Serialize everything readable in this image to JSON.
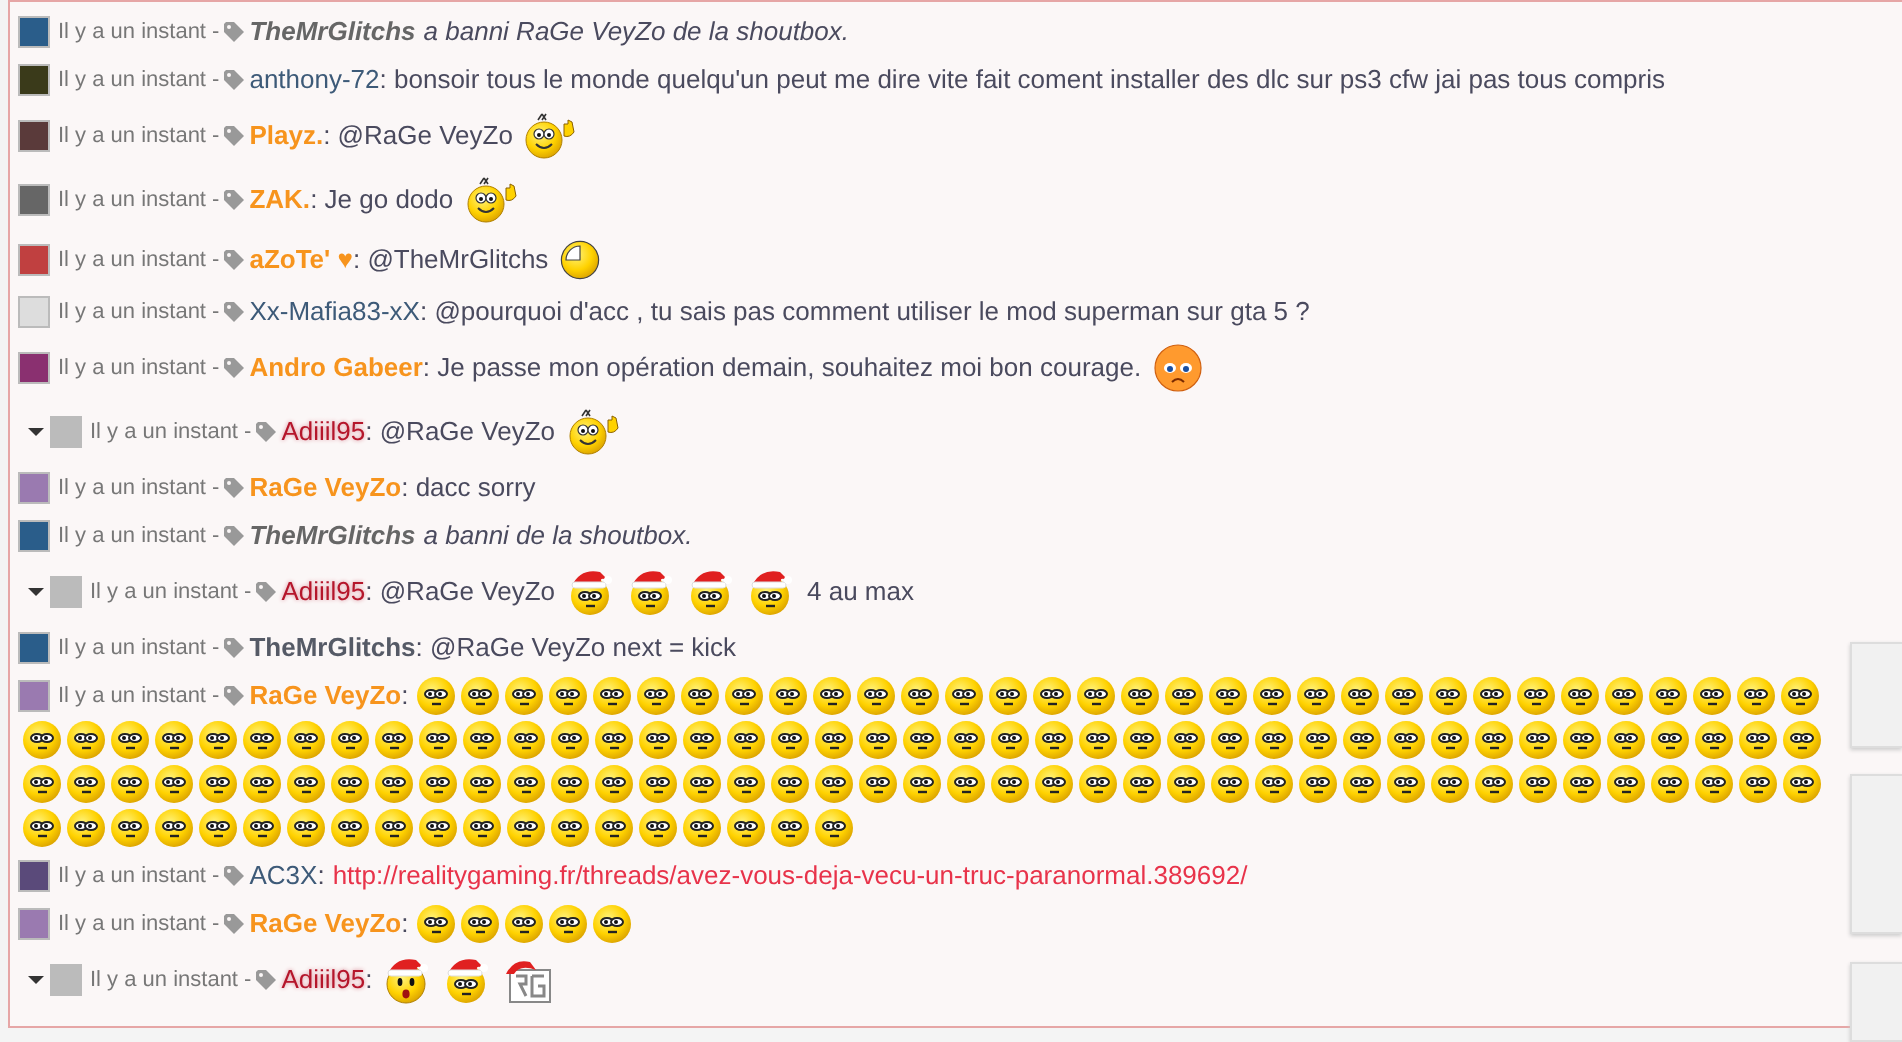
{
  "messages": [
    {
      "time": "Il y a un instant - ",
      "kind": "system",
      "caret": false,
      "user": "TheMrGlitchs",
      "text": "a banni RaGe VeyZo de la shoutbox."
    },
    {
      "time": "Il y a un instant - ",
      "kind": "member",
      "caret": false,
      "user": "anthony-72",
      "text": ": bonsoir tous le monde quelqu'un peut me dire vite fait coment installer des dlc sur ps3 cfw jai pas tous compris"
    },
    {
      "time": "Il y a un instant - ",
      "kind": "vip",
      "caret": false,
      "user": "Playz.",
      "text": ": @RaGe VeyZo",
      "emoticons": [
        {
          "kind": "wave"
        }
      ]
    },
    {
      "time": "Il y a un instant - ",
      "kind": "vip",
      "caret": false,
      "user": "ZAK.",
      "text": ": Je go dodo",
      "emoticons": [
        {
          "kind": "wave"
        }
      ]
    },
    {
      "time": "Il y a un instant - ",
      "kind": "vip",
      "caret": false,
      "user": "aZoTe' ♥",
      "text": ": @TheMrGlitchs",
      "emoticons": [
        {
          "kind": "clock"
        }
      ]
    },
    {
      "time": "Il y a un instant - ",
      "kind": "member",
      "caret": false,
      "user": "Xx-Mafia83-xX",
      "text": ": @pourquoi d'acc , tu sais pas comment utiliser le mod superman sur gta 5 ?"
    },
    {
      "time": "Il y a un instant - ",
      "kind": "vip",
      "caret": false,
      "user": "Andro Gabeer",
      "text": ": Je passe mon opération demain, souhaitez moi bon courage.",
      "emoticons": [
        {
          "kind": "sad"
        }
      ]
    },
    {
      "time": "Il y a un instant - ",
      "kind": "staff",
      "caret": true,
      "user": "Adiiil95",
      "text": ": @RaGe VeyZo",
      "emoticons": [
        {
          "kind": "wave"
        }
      ]
    },
    {
      "time": "Il y a un instant - ",
      "kind": "vip",
      "caret": false,
      "user": "RaGe VeyZo",
      "text": ": dacc sorry"
    },
    {
      "time": "Il y a un instant - ",
      "kind": "system",
      "caret": false,
      "user": "TheMrGlitchs",
      "text": "a banni de la shoutbox."
    },
    {
      "time": "Il y a un instant - ",
      "kind": "staff",
      "caret": true,
      "user": "Adiiil95",
      "text": ": @RaGe VeyZo",
      "emoticons": [
        {
          "kind": "santa"
        },
        {
          "kind": "santa"
        },
        {
          "kind": "santa"
        },
        {
          "kind": "santa"
        }
      ],
      "after": "4 au max"
    },
    {
      "time": "Il y a un instant - ",
      "kind": "admin",
      "caret": false,
      "user": "TheMrGlitchs",
      "text": ": @RaGe VeyZo next = kick"
    },
    {
      "time": "Il y a un instant - ",
      "kind": "vip",
      "caret": false,
      "user": "RaGe VeyZo",
      "text": ":",
      "emoticons": [
        {
          "kind": "cool"
        },
        {
          "kind": "cool"
        },
        {
          "kind": "cool"
        },
        {
          "kind": "cool"
        },
        {
          "kind": "cool"
        },
        {
          "kind": "cool"
        },
        {
          "kind": "cool"
        },
        {
          "kind": "cool"
        },
        {
          "kind": "cool"
        },
        {
          "kind": "cool"
        },
        {
          "kind": "cool"
        },
        {
          "kind": "cool"
        },
        {
          "kind": "cool"
        },
        {
          "kind": "cool"
        },
        {
          "kind": "cool"
        },
        {
          "kind": "cool"
        },
        {
          "kind": "cool"
        },
        {
          "kind": "cool"
        },
        {
          "kind": "cool"
        },
        {
          "kind": "cool"
        },
        {
          "kind": "cool"
        },
        {
          "kind": "cool"
        },
        {
          "kind": "cool"
        },
        {
          "kind": "cool"
        },
        {
          "kind": "cool"
        },
        {
          "kind": "cool"
        },
        {
          "kind": "cool"
        },
        {
          "kind": "cool"
        },
        {
          "kind": "cool"
        },
        {
          "kind": "cool"
        },
        {
          "kind": "cool"
        },
        {
          "kind": "cool"
        },
        {
          "kind": "cool"
        },
        {
          "kind": "cool"
        },
        {
          "kind": "cool"
        },
        {
          "kind": "cool"
        },
        {
          "kind": "cool"
        },
        {
          "kind": "cool"
        },
        {
          "kind": "cool"
        },
        {
          "kind": "cool"
        },
        {
          "kind": "cool"
        },
        {
          "kind": "cool"
        },
        {
          "kind": "cool"
        },
        {
          "kind": "cool"
        },
        {
          "kind": "cool"
        },
        {
          "kind": "cool"
        },
        {
          "kind": "cool"
        },
        {
          "kind": "cool"
        },
        {
          "kind": "cool"
        },
        {
          "kind": "cool"
        },
        {
          "kind": "cool"
        },
        {
          "kind": "cool"
        },
        {
          "kind": "cool"
        },
        {
          "kind": "cool"
        },
        {
          "kind": "cool"
        },
        {
          "kind": "cool"
        },
        {
          "kind": "cool"
        },
        {
          "kind": "cool"
        },
        {
          "kind": "cool"
        },
        {
          "kind": "cool"
        },
        {
          "kind": "cool"
        },
        {
          "kind": "cool"
        },
        {
          "kind": "cool"
        },
        {
          "kind": "cool"
        },
        {
          "kind": "cool"
        },
        {
          "kind": "cool"
        },
        {
          "kind": "cool"
        },
        {
          "kind": "cool"
        },
        {
          "kind": "cool"
        },
        {
          "kind": "cool"
        },
        {
          "kind": "cool"
        },
        {
          "kind": "cool"
        },
        {
          "kind": "cool"
        },
        {
          "kind": "cool"
        },
        {
          "kind": "cool"
        },
        {
          "kind": "cool"
        },
        {
          "kind": "cool"
        },
        {
          "kind": "cool"
        },
        {
          "kind": "cool"
        },
        {
          "kind": "cool"
        },
        {
          "kind": "cool"
        },
        {
          "kind": "cool"
        },
        {
          "kind": "cool"
        },
        {
          "kind": "cool"
        },
        {
          "kind": "cool"
        },
        {
          "kind": "cool"
        },
        {
          "kind": "cool"
        },
        {
          "kind": "cool"
        },
        {
          "kind": "cool"
        },
        {
          "kind": "cool"
        },
        {
          "kind": "cool"
        },
        {
          "kind": "cool"
        },
        {
          "kind": "cool"
        },
        {
          "kind": "cool"
        },
        {
          "kind": "cool"
        },
        {
          "kind": "cool"
        },
        {
          "kind": "cool"
        },
        {
          "kind": "cool"
        },
        {
          "kind": "cool"
        },
        {
          "kind": "cool"
        },
        {
          "kind": "cool"
        },
        {
          "kind": "cool"
        },
        {
          "kind": "cool"
        },
        {
          "kind": "cool"
        },
        {
          "kind": "cool"
        },
        {
          "kind": "cool"
        },
        {
          "kind": "cool"
        },
        {
          "kind": "cool"
        },
        {
          "kind": "cool"
        },
        {
          "kind": "cool"
        },
        {
          "kind": "cool"
        },
        {
          "kind": "cool"
        },
        {
          "kind": "cool"
        },
        {
          "kind": "cool"
        },
        {
          "kind": "cool"
        },
        {
          "kind": "cool"
        },
        {
          "kind": "cool"
        },
        {
          "kind": "cool"
        },
        {
          "kind": "cool"
        },
        {
          "kind": "cool"
        },
        {
          "kind": "cool"
        },
        {
          "kind": "cool"
        },
        {
          "kind": "cool"
        },
        {
          "kind": "cool"
        },
        {
          "kind": "cool"
        },
        {
          "kind": "cool"
        },
        {
          "kind": "cool"
        },
        {
          "kind": "cool"
        },
        {
          "kind": "cool"
        },
        {
          "kind": "cool"
        },
        {
          "kind": "cool"
        },
        {
          "kind": "cool"
        },
        {
          "kind": "cool"
        }
      ]
    },
    {
      "time": "Il y a un instant - ",
      "kind": "member",
      "caret": false,
      "user": "AC3X",
      "text": ":",
      "link": "http://realitygaming.fr/threads/avez-vous-deja-vecu-un-truc-paranormal.389692/"
    },
    {
      "time": "Il y a un instant - ",
      "kind": "vip",
      "caret": false,
      "user": "RaGe VeyZo",
      "text": ":",
      "emoticons": [
        {
          "kind": "cool"
        },
        {
          "kind": "cool"
        },
        {
          "kind": "cool"
        },
        {
          "kind": "cool"
        },
        {
          "kind": "cool"
        }
      ]
    },
    {
      "time": "Il y a un instant - ",
      "kind": "staff",
      "caret": true,
      "user": "Adiiil95",
      "text": ":",
      "emoticons": [
        {
          "kind": "santa-shocked"
        },
        {
          "kind": "santa"
        },
        {
          "kind": "logo"
        }
      ]
    }
  ]
}
